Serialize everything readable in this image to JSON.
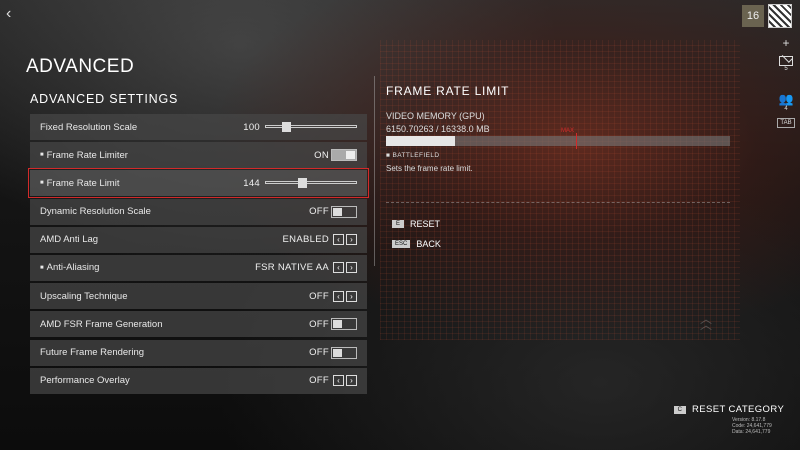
{
  "header": {
    "back_icon": "‹",
    "level": "16"
  },
  "page_title": "ADVANCED",
  "section_title": "ADVANCED SETTINGS",
  "settings": [
    {
      "label": "Fixed Resolution Scale",
      "value": "100",
      "control": "slider",
      "level": 0.2,
      "marked": false
    },
    {
      "label": "Frame Rate Limiter",
      "value": "ON",
      "control": "toggle-on",
      "marked": true
    },
    {
      "label": "Frame Rate Limit",
      "value": "144",
      "control": "slider",
      "level": 0.4,
      "marked": true,
      "selected": true
    },
    {
      "label": "Dynamic Resolution Scale",
      "value": "OFF",
      "control": "toggle-off",
      "marked": false
    },
    {
      "label": "AMD Anti Lag",
      "value": "ENABLED",
      "control": "arrows",
      "marked": false
    },
    {
      "label": "Anti-Aliasing",
      "value": "FSR NATIVE AA",
      "control": "arrows",
      "marked": true
    },
    {
      "label": "Upscaling Technique",
      "value": "OFF",
      "control": "arrows",
      "marked": false
    },
    {
      "label": "AMD FSR Frame Generation",
      "value": "OFF",
      "control": "toggle-off",
      "marked": false
    },
    {
      "label": "Future Frame Rendering",
      "value": "OFF",
      "control": "toggle-off",
      "marked": false
    },
    {
      "label": "Performance Overlay",
      "value": "OFF",
      "control": "arrows",
      "marked": false
    }
  ],
  "detail": {
    "title": "FRAME RATE LIMIT",
    "vm_label": "VIDEO MEMORY (GPU)",
    "vm_value": "6150.70263 / 16338.0 MB",
    "vm_fraction": 0.2,
    "vm_max_label": "MAX",
    "tag": "BATTLEFIELD",
    "description": "Sets the frame rate limit.",
    "actions": [
      {
        "key": "E",
        "label": "RESET"
      },
      {
        "key": "ESC",
        "label": "BACK"
      }
    ]
  },
  "side": {
    "plus": "+",
    "mail_count": "5",
    "friends_count": "4",
    "tab_key": "TAB"
  },
  "footer": {
    "reset_key": "C",
    "reset_label": "RESET CATEGORY",
    "version_lines": [
      "Version: 8.17.8",
      "Code: 24,641,779",
      "Data: 24,641,779"
    ]
  },
  "colors": {
    "accent_red": "#d22a2a",
    "row_bg": "#464646"
  }
}
